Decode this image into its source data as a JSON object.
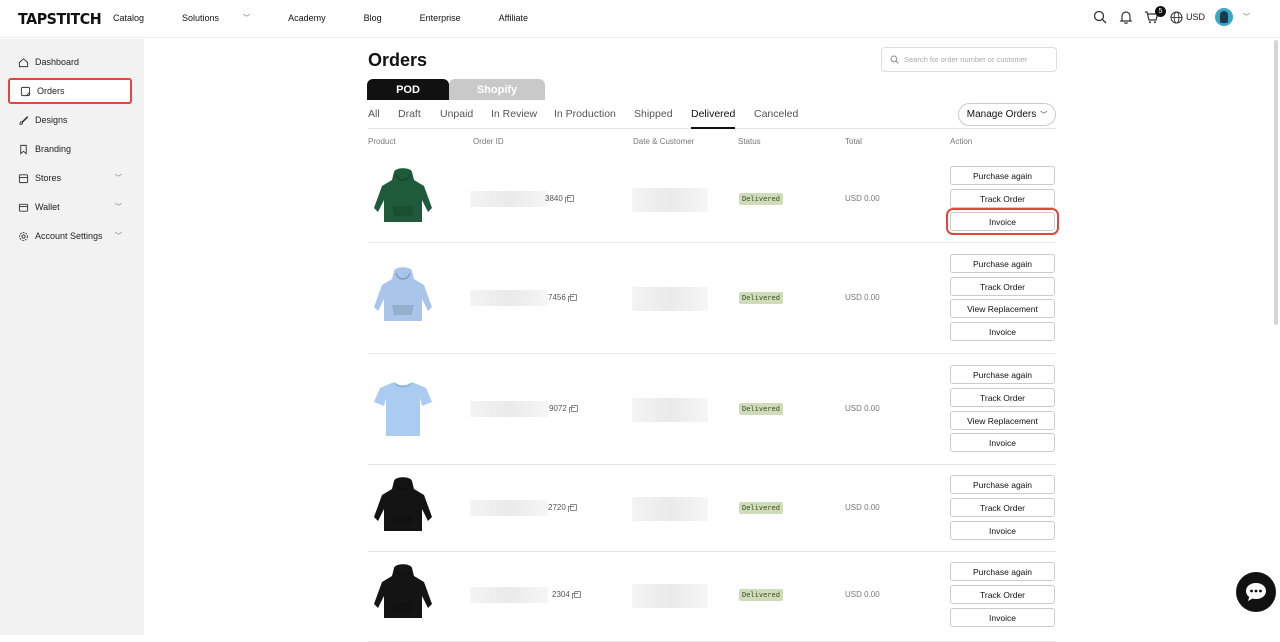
{
  "brand": "TAPSTITCH",
  "nav": {
    "links": [
      {
        "label": "Catalog",
        "dropdown": false
      },
      {
        "label": "Solutions",
        "dropdown": true
      },
      {
        "label": "Academy",
        "dropdown": false
      },
      {
        "label": "Blog",
        "dropdown": false
      },
      {
        "label": "Enterprise",
        "dropdown": false
      },
      {
        "label": "Affiliate",
        "dropdown": false
      }
    ],
    "cart_count": "5",
    "currency": "USD"
  },
  "sidebar": {
    "items": [
      {
        "label": "Dashboard",
        "icon": "home-icon",
        "expandable": false
      },
      {
        "label": "Orders",
        "icon": "orders-icon",
        "expandable": false,
        "active": true
      },
      {
        "label": "Designs",
        "icon": "brush-icon",
        "expandable": false
      },
      {
        "label": "Branding",
        "icon": "bookmark-icon",
        "expandable": false
      },
      {
        "label": "Stores",
        "icon": "store-icon",
        "expandable": true
      },
      {
        "label": "Wallet",
        "icon": "wallet-icon",
        "expandable": true
      },
      {
        "label": "Account Settings",
        "icon": "gear-icon",
        "expandable": true
      }
    ]
  },
  "main": {
    "title": "Orders",
    "search_placeholder": "Search for order number or customer",
    "segments": {
      "pod": "POD",
      "shopify": "Shopify"
    },
    "tabs": [
      "All",
      "Draft",
      "Unpaid",
      "In Review",
      "In Production",
      "Shipped",
      "Delivered",
      "Canceled"
    ],
    "active_tab": "Delivered",
    "manage_orders": "Manage Orders",
    "columns": [
      "Product",
      "Order ID",
      "Date & Customer",
      "Status",
      "Total",
      "Action"
    ],
    "orders": [
      {
        "product": "green hoodie",
        "color": "#1f5a3a",
        "type": "hoodie",
        "order_id_suffix": "3840",
        "status": "Delivered",
        "total": "USD 0.00",
        "actions": [
          "Purchase again",
          "Track Order",
          "Invoice"
        ]
      },
      {
        "product": "light blue hoodie",
        "color": "#a9c6ea",
        "type": "hoodie",
        "order_id_suffix": "7456",
        "status": "Delivered",
        "total": "USD 0.00",
        "actions": [
          "Purchase again",
          "Track Order",
          "View Replacement",
          "Invoice"
        ]
      },
      {
        "product": "light blue t-shirt",
        "color": "#a9ccf0",
        "type": "tshirt",
        "order_id_suffix": "9072",
        "status": "Delivered",
        "total": "USD 0.00",
        "actions": [
          "Purchase again",
          "Track Order",
          "View Replacement",
          "Invoice"
        ]
      },
      {
        "product": "black hoodie",
        "color": "#141414",
        "type": "hoodie",
        "order_id_suffix": "2720",
        "status": "Delivered",
        "total": "USD 0.00",
        "actions": [
          "Purchase again",
          "Track Order",
          "Invoice"
        ]
      },
      {
        "product": "black hoodie",
        "color": "#141414",
        "type": "hoodie",
        "order_id_suffix": "2304",
        "status": "Delivered",
        "total": "USD 0.00",
        "actions": [
          "Purchase again",
          "Track Order",
          "Invoice"
        ]
      }
    ]
  }
}
